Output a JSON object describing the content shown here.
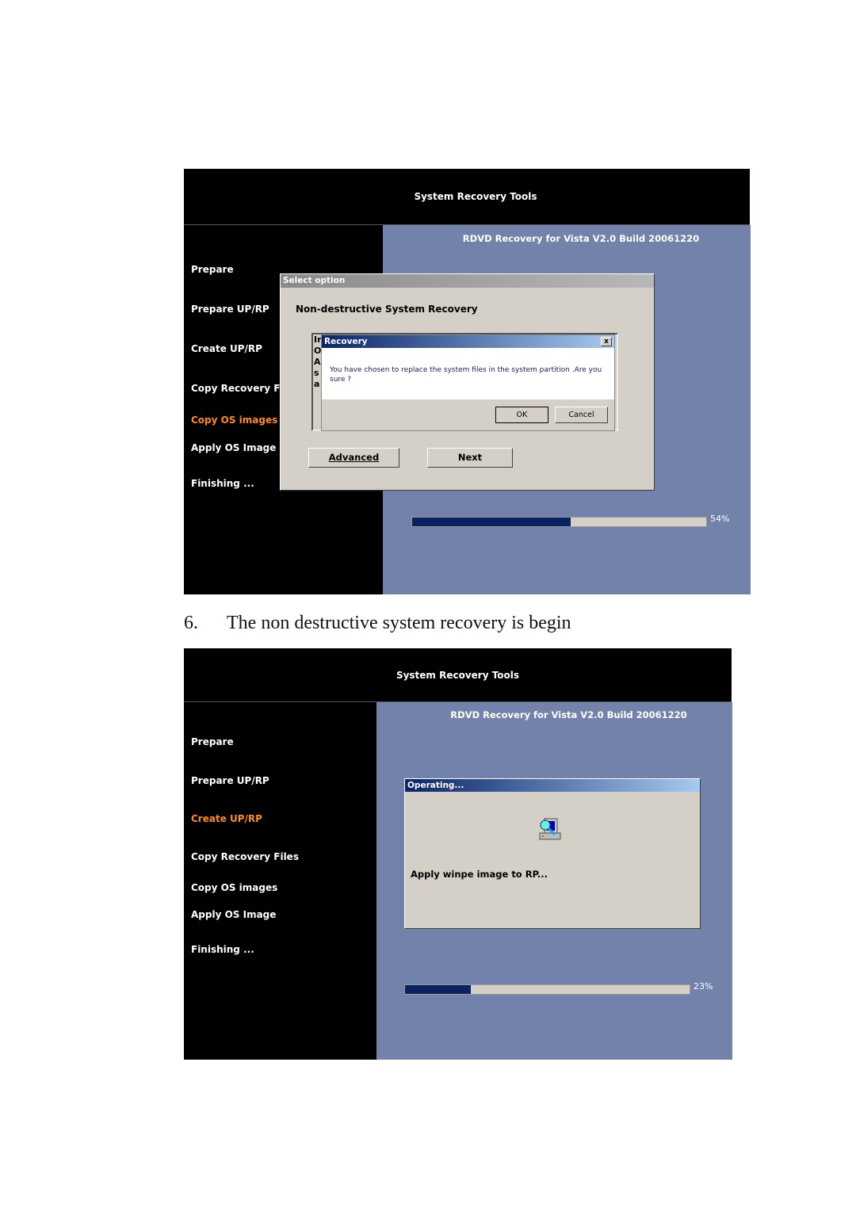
{
  "screen1": {
    "header_title": "System Recovery Tools",
    "build": "RDVD Recovery for Vista V2.0 Build 20061220",
    "nav": [
      {
        "label": "Prepare"
      },
      {
        "label": "Prepare UP/RP"
      },
      {
        "label": "Create UP/RP"
      },
      {
        "label": "Copy Recovery Files"
      },
      {
        "label": "Copy OS images",
        "active": true
      },
      {
        "label": "Apply OS Image"
      },
      {
        "label": "Finishing ..."
      }
    ],
    "select_dialog": {
      "title": "Select option",
      "heading": "Non-destructive System Recovery",
      "clipped_letters": [
        "Ir",
        "O",
        "A",
        "s",
        "a"
      ],
      "advanced": "Advanced",
      "next": "Next"
    },
    "recovery_dialog": {
      "title": "Recovery",
      "message": "You have chosen to replace the system files in the system  partition .Are you sure ?",
      "ok": "OK",
      "cancel": "Cancel",
      "close": "x"
    },
    "progress": {
      "value": 54,
      "label": "54%"
    }
  },
  "caption": {
    "number": "6.",
    "text": "The non destructive system recovery is begin"
  },
  "screen2": {
    "header_title": "System Recovery Tools",
    "build": "RDVD Recovery for Vista V2.0 Build 20061220",
    "nav": [
      {
        "label": "Prepare"
      },
      {
        "label": "Prepare UP/RP"
      },
      {
        "label": "Create UP/RP",
        "active": true
      },
      {
        "label": "Copy Recovery Files"
      },
      {
        "label": "Copy OS images"
      },
      {
        "label": "Apply OS Image"
      },
      {
        "label": "Finishing ..."
      }
    ],
    "operating_dialog": {
      "title": "Operating...",
      "message": "Apply winpe image to RP...",
      "icon": "computer-search-icon"
    },
    "progress": {
      "value": 23,
      "label": "23%"
    }
  },
  "colors": {
    "panel_blue": "#7282ab",
    "active_nav": "#ff8c1a",
    "progress_fill": "#0a2262",
    "dialog_gray": "#d4d0c8"
  }
}
